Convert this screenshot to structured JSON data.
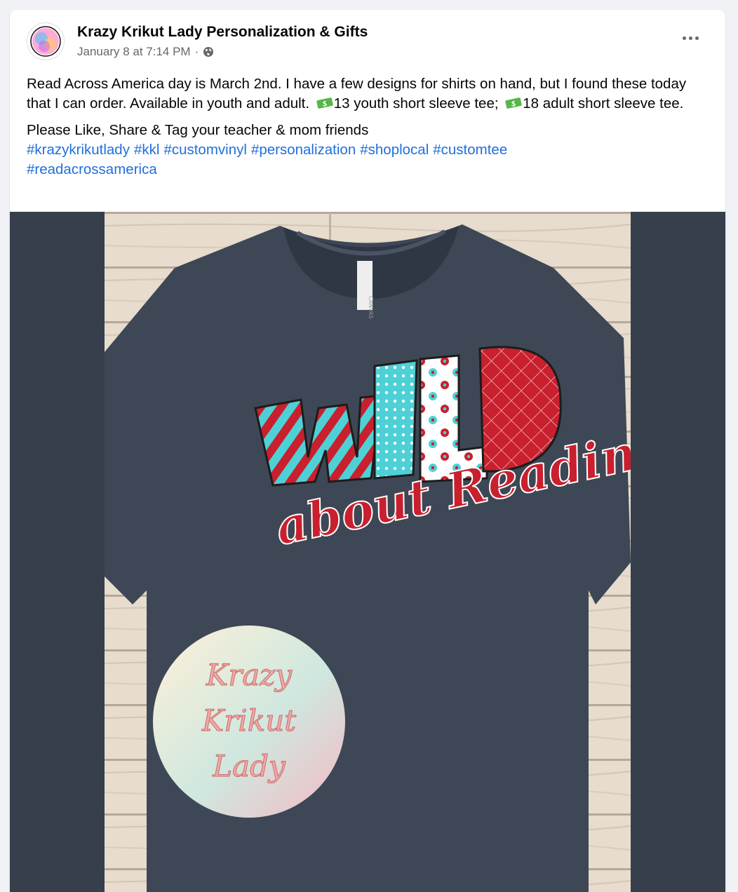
{
  "post": {
    "author": "Krazy Krikut Lady Personalization & Gifts",
    "timestamp": "January 8 at 7:14 PM",
    "separator": "·",
    "audience_icon": "globe-icon",
    "avatar_text": "Krazy Krikut Lady",
    "more_icon": "more-options-icon",
    "body": {
      "line1": "Read Across America day is March 2nd. I have a few designs for shirts on hand,  but I found these today that I can order.  Available in youth and adult. ",
      "price1": "13 youth short sleeve tee; ",
      "price2": "18 adult short sleeve tee.",
      "line2": "Please Like, Share & Tag your teacher & mom friends"
    },
    "hashtags": [
      "#krazykrikutlady",
      "#kkl",
      "#customvinyl",
      "#personalization",
      "#shoplocal",
      "#customtee",
      "#readacrossamerica"
    ]
  },
  "image": {
    "shirt_word": "WILD",
    "shirt_subtitle": "about Reading",
    "tag_text": "CANVAS",
    "watermark_line1": "Krazy",
    "watermark_line2": "Krikut",
    "watermark_line3": "Lady"
  },
  "colors": {
    "link": "#216fdb",
    "media_bg": "#373f4d",
    "shirt": "#3e4755",
    "red": "#c8202e",
    "teal": "#4ed1d6"
  }
}
